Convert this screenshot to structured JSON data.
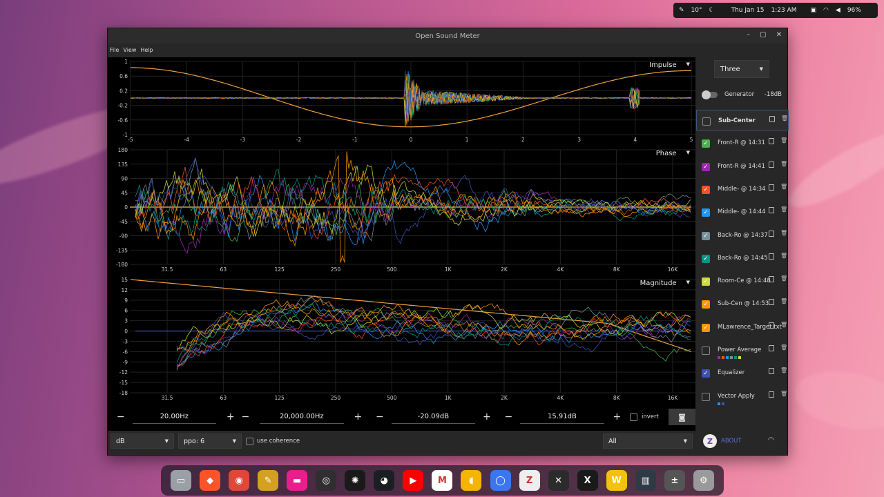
{
  "topbar": {
    "temp": "10°",
    "date": "Thu Jan 15",
    "time": "1:23 AM",
    "battery": "96%"
  },
  "window": {
    "title": "Open Sound Meter"
  },
  "menu": [
    "File",
    "View",
    "Help"
  ],
  "plots": {
    "impulse": {
      "label": "Impulse",
      "y_ticks": [
        "1",
        "0.6",
        "0.2",
        "-0.2",
        "-0.6",
        "-1"
      ],
      "x_ticks": [
        "-5",
        "-4",
        "-3",
        "-2",
        "-1",
        "0",
        "1",
        "2",
        "3",
        "4",
        "5"
      ]
    },
    "phase": {
      "label": "Phase",
      "y_ticks": [
        "180",
        "135",
        "90",
        "45",
        "0",
        "-45",
        "-90",
        "-135",
        "-180"
      ],
      "x_ticks": [
        "31.5",
        "63",
        "125",
        "250",
        "500",
        "1K",
        "2K",
        "4K",
        "8K",
        "16K"
      ]
    },
    "magnitude": {
      "label": "Magnitude",
      "y_ticks": [
        "15",
        "12",
        "9",
        "6",
        "3",
        "0",
        "-3",
        "-6",
        "-9",
        "-12",
        "-15",
        "-18"
      ],
      "x_ticks": [
        "31.5",
        "63",
        "125",
        "250",
        "500",
        "1K",
        "2K",
        "4K",
        "8K",
        "16K"
      ]
    }
  },
  "controls": {
    "freq_min": "20.00Hz",
    "freq_max": "20,000.00Hz",
    "db_min": "-20.09dB",
    "db_max": "15.91dB",
    "invert_label": "invert",
    "unit": "dB",
    "ppo": "ppo: 6",
    "coherence_label": "use coherence",
    "filter": "All",
    "about": "ABOUT"
  },
  "side": {
    "preset": "Three",
    "generator_label": "Generator",
    "generator_level": "-18dB",
    "sources": [
      {
        "name": "Sub-Center",
        "checked": false,
        "color": "#888888"
      },
      {
        "name": "Front-R @ 14:31",
        "checked": true,
        "color": "#4caf50"
      },
      {
        "name": "Front-R @ 14:41",
        "checked": true,
        "color": "#9c27b0"
      },
      {
        "name": "Middle- @ 14:34",
        "checked": true,
        "color": "#f4511e"
      },
      {
        "name": "Middle- @ 14:44",
        "checked": true,
        "color": "#2196f3"
      },
      {
        "name": "Back-Ro @ 14:37",
        "checked": true,
        "color": "#78909c"
      },
      {
        "name": "Back-Ro @ 14:45",
        "checked": true,
        "color": "#009688"
      },
      {
        "name": "Room-Ce @ 14:48",
        "checked": true,
        "color": "#cddc39"
      },
      {
        "name": "Sub-Cen @ 14:53",
        "checked": true,
        "color": "#ff9800"
      },
      {
        "name": "MLawrence_Target.txt",
        "checked": true,
        "color": "#ff9800"
      },
      {
        "name": "Power Average",
        "checked": false,
        "color": "#888888"
      },
      {
        "name": "Equalizer",
        "checked": true,
        "color": "#3f51b5"
      },
      {
        "name": "Vector Apply",
        "checked": false,
        "color": "#888888"
      }
    ]
  },
  "dock": [
    "Files",
    "Brave",
    "Chrome",
    "Pen",
    "Window",
    "OBS",
    "ChatGPT",
    "GitHub",
    "YouTube",
    "Gmail",
    "Keep",
    "Signal",
    "Mail",
    "AIR",
    "EDIT",
    "W",
    "Mixer",
    "Calc",
    "Settings"
  ]
}
